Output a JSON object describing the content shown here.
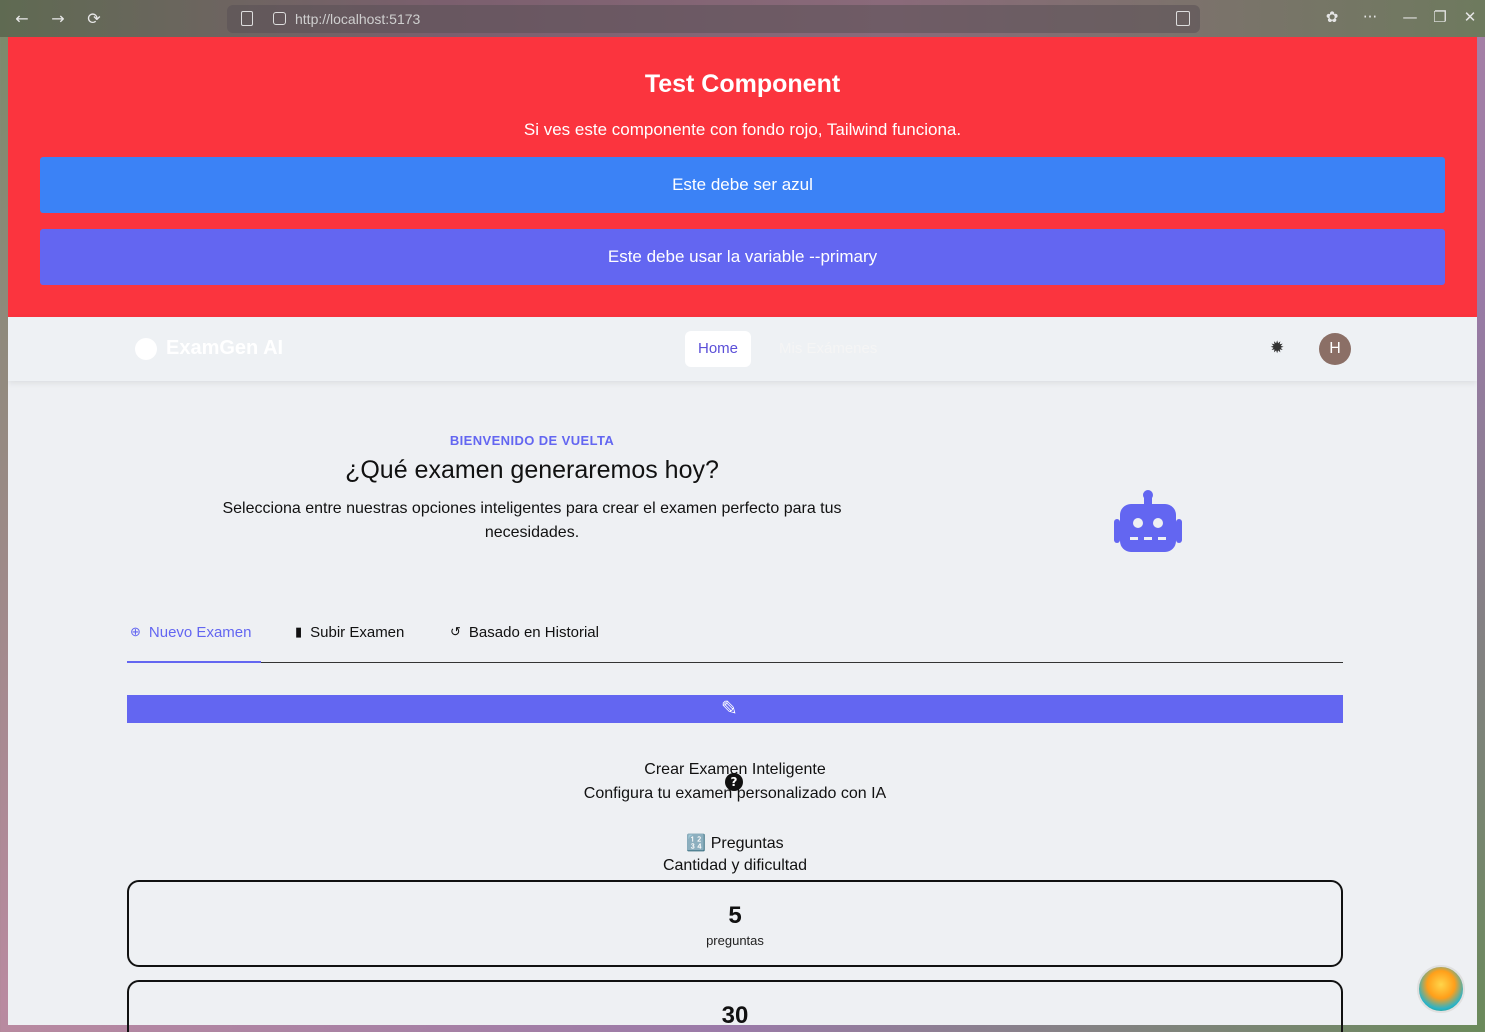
{
  "browser": {
    "url": "http://localhost:5173",
    "back": "←",
    "forward": "→",
    "reload": "⟳",
    "menu": "···",
    "minimize": "—",
    "maximize": "❐",
    "close": "✕"
  },
  "test_component": {
    "title": "Test Component",
    "description": "Si ves este componente con fondo rojo, Tailwind funciona.",
    "blue_button": "Este debe ser azul",
    "primary_button": "Este debe usar la variable --primary",
    "background_color": "#fb343e",
    "blue_color": "#3b82f6",
    "primary_color": "#6366f1"
  },
  "navbar": {
    "brand": "ExamGen AI",
    "links": [
      "Home",
      "Mis Exámenes"
    ],
    "avatar_initial": "H",
    "theme_icon": "gear-icon"
  },
  "hero": {
    "eyebrow": "BIENVENIDO DE VUELTA",
    "title": "¿Qué examen generaremos hoy?",
    "description": "Selecciona entre nuestras opciones inteligentes para crear el examen perfecto para tus necesidades.",
    "icon": "robot-icon"
  },
  "tabs": [
    {
      "label": "Nuevo Examen",
      "icon": "plus-circle-icon",
      "active": true
    },
    {
      "label": "Subir Examen",
      "icon": "file-upload-icon",
      "active": false
    },
    {
      "label": "Basado en Historial",
      "icon": "history-icon",
      "active": false
    }
  ],
  "exam_card": {
    "title": "Crear Examen Inteligente",
    "subtitle": "Configura tu examen personalizado con IA",
    "help": "?",
    "section_title": "🔢 Preguntas",
    "section_subtitle": "Cantidad y dificultad",
    "options": [
      {
        "value": "5",
        "label": "preguntas"
      },
      {
        "value": "30",
        "label": ""
      }
    ]
  }
}
